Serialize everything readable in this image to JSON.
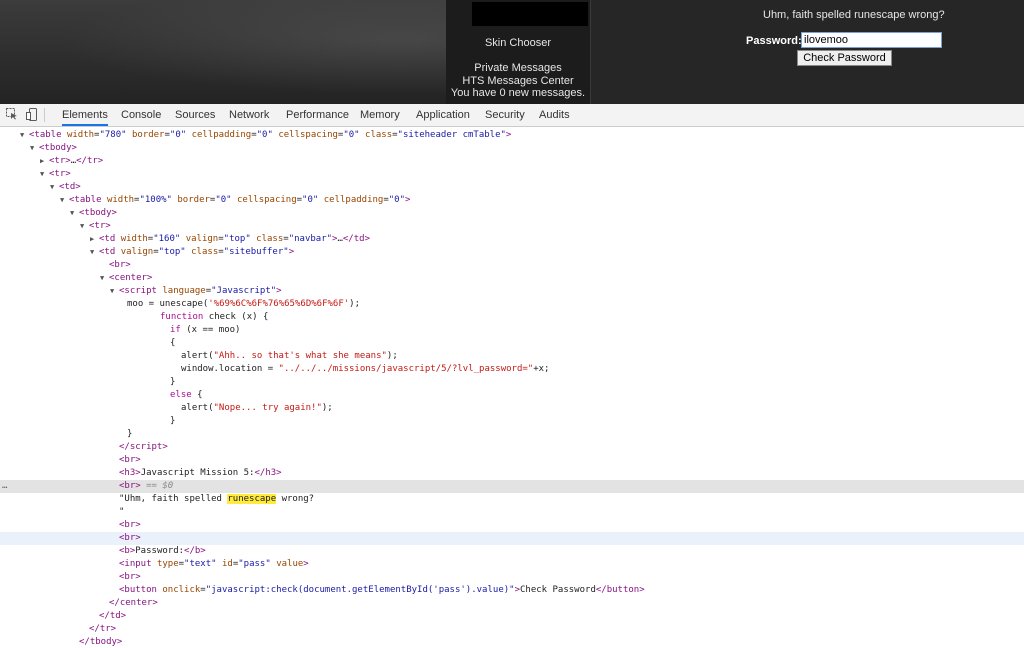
{
  "site": {
    "nav": {
      "skin_chooser": "Skin Chooser",
      "private_messages": "Private Messages",
      "hts_messages_center": "HTS Messages Center",
      "new_messages": "You have 0 new messages."
    },
    "mission": {
      "message": "Uhm, faith spelled runescape wrong?",
      "password_label": "Password:",
      "password_value": "ilovemoo",
      "check_button": "Check Password"
    }
  },
  "devtools": {
    "tabs": [
      "Elements",
      "Console",
      "Sources",
      "Network",
      "Performance",
      "Memory",
      "Application",
      "Security",
      "Audits"
    ],
    "active_tab": "Elements",
    "icons": [
      "inspect-icon",
      "device-toggle-icon"
    ],
    "lines": [
      {
        "indent": 0,
        "tri": "open",
        "html": "<span class='tag'>&lt;table</span> <span class='an'>width</span>=<span class='av'>\"780\"</span> <span class='an'>border</span>=<span class='av'>\"0\"</span> <span class='an'>cellpadding</span>=<span class='av'>\"0\"</span> <span class='an'>cellspacing</span>=<span class='av'>\"0\"</span> <span class='an'>class</span>=<span class='av'>\"siteheader cmTable\"</span><span class='tag'>&gt;</span>"
      },
      {
        "indent": 1,
        "tri": "open",
        "html": "<span class='tag'>&lt;tbody&gt;</span>"
      },
      {
        "indent": 2,
        "tri": "closed",
        "html": "<span class='tag'>&lt;tr&gt;</span>…<span class='tag'>&lt;/tr&gt;</span>"
      },
      {
        "indent": 2,
        "tri": "open",
        "html": "<span class='tag'>&lt;tr&gt;</span>"
      },
      {
        "indent": 3,
        "tri": "open",
        "html": "<span class='tag'>&lt;td&gt;</span>"
      },
      {
        "indent": 4,
        "tri": "open",
        "html": "<span class='tag'>&lt;table</span> <span class='an'>width</span>=<span class='av'>\"100%\"</span> <span class='an'>border</span>=<span class='av'>\"0\"</span> <span class='an'>cellspacing</span>=<span class='av'>\"0\"</span> <span class='an'>cellpadding</span>=<span class='av'>\"0\"</span><span class='tag'>&gt;</span>"
      },
      {
        "indent": 5,
        "tri": "open",
        "html": "<span class='tag'>&lt;tbody&gt;</span>"
      },
      {
        "indent": 6,
        "tri": "open",
        "html": "<span class='tag'>&lt;tr&gt;</span>"
      },
      {
        "indent": 7,
        "tri": "closed",
        "html": "<span class='tag'>&lt;td</span> <span class='an'>width</span>=<span class='av'>\"160\"</span> <span class='an'>valign</span>=<span class='av'>\"top\"</span> <span class='an'>class</span>=<span class='av'>\"navbar\"</span><span class='tag'>&gt;</span>…<span class='tag'>&lt;/td&gt;</span>"
      },
      {
        "indent": 7,
        "tri": "open",
        "html": "<span class='tag'>&lt;td</span> <span class='an'>valign</span>=<span class='av'>\"top\"</span> <span class='an'>class</span>=<span class='av'>\"sitebuffer\"</span><span class='tag'>&gt;</span>"
      },
      {
        "indent": 8,
        "tri": "none",
        "html": "<span class='tag'>&lt;br&gt;</span>"
      },
      {
        "indent": 8,
        "tri": "open",
        "html": "<span class='tag'>&lt;center&gt;</span>"
      },
      {
        "indent": 9,
        "tri": "open",
        "html": "<span class='tag'>&lt;script</span> <span class='an'>language</span>=<span class='av'>\"Javascript\"</span><span class='tag'>&gt;</span>"
      },
      {
        "indent": 0,
        "tri": "none",
        "pad": 127,
        "html": "<span class='js'>moo = unescape(</span><span class='str'>'%69%6C%6F%76%65%6D%6F%6F'</span><span class='js'>);</span>"
      },
      {
        "indent": 0,
        "tri": "none",
        "pad": 160,
        "html": "<span class='kw'>function</span><span class='js'> check (x) {</span>"
      },
      {
        "indent": 0,
        "tri": "none",
        "pad": 170,
        "html": "<span class='kw'>if</span><span class='js'> (x == moo)</span>"
      },
      {
        "indent": 0,
        "tri": "none",
        "pad": 170,
        "html": "<span class='js'>{</span>"
      },
      {
        "indent": 0,
        "tri": "none",
        "pad": 181,
        "html": "<span class='js'>alert(</span><span class='str'>\"Ahh.. so that's what she means\"</span><span class='js'>);</span>"
      },
      {
        "indent": 0,
        "tri": "none",
        "pad": 181,
        "html": "<span class='js'>window.location = </span><span class='str'>\"../../../missions/javascript/5/?lvl_password=\"</span><span class='js'>+x;</span>"
      },
      {
        "indent": 0,
        "tri": "none",
        "pad": 170,
        "html": "<span class='js'>}</span>"
      },
      {
        "indent": 0,
        "tri": "none",
        "pad": 170,
        "html": "<span class='kw'>else</span><span class='js'> {</span>"
      },
      {
        "indent": 0,
        "tri": "none",
        "pad": 181,
        "html": "<span class='js'>alert(</span><span class='str'>\"Nope... try again!\"</span><span class='js'>);</span>"
      },
      {
        "indent": 0,
        "tri": "none",
        "pad": 170,
        "html": "<span class='js'>}</span>"
      },
      {
        "indent": 0,
        "tri": "none",
        "pad": 127,
        "html": "<span class='js'>}</span>"
      },
      {
        "indent": 9,
        "tri": "none",
        "html": "<span class='tag'>&lt;/script&gt;</span>"
      },
      {
        "indent": 9,
        "tri": "none",
        "html": "<span class='tag'>&lt;br&gt;</span>"
      },
      {
        "indent": 9,
        "tri": "none",
        "html": "<span class='tag'>&lt;h3&gt;</span>Javascript Mission 5:<span class='tag'>&lt;/h3&gt;</span>"
      },
      {
        "indent": 9,
        "tri": "none",
        "cls": "sel",
        "dots": true,
        "html": "<span class='tag'>&lt;br&gt;</span> <span class='eq'>== $0</span>"
      },
      {
        "indent": 9,
        "tri": "none",
        "html": "\"Uhm, faith spelled <span class='hl'>runescape</span> wrong?"
      },
      {
        "indent": 9,
        "tri": "none",
        "html": "\""
      },
      {
        "indent": 9,
        "tri": "none",
        "html": "<span class='tag'>&lt;br&gt;</span>"
      },
      {
        "indent": 9,
        "tri": "none",
        "cls": "hov",
        "html": "<span class='tag'>&lt;br&gt;</span>"
      },
      {
        "indent": 9,
        "tri": "none",
        "html": "<span class='tag'>&lt;b&gt;</span>Password:<span class='tag'>&lt;/b&gt;</span>"
      },
      {
        "indent": 9,
        "tri": "none",
        "html": "<span class='tag'>&lt;input</span> <span class='an'>type</span>=<span class='av'>\"text\"</span> <span class='an'>id</span>=<span class='av'>\"pass\"</span> <span class='an'>value</span><span class='tag'>&gt;</span>"
      },
      {
        "indent": 9,
        "tri": "none",
        "html": "<span class='tag'>&lt;br&gt;</span>"
      },
      {
        "indent": 9,
        "tri": "none",
        "html": "<span class='tag'>&lt;button</span> <span class='an'>onclick</span>=<span class='av'>\"javascript:check(document.getElementById('pass').value)\"</span><span class='tag'>&gt;</span>Check Password<span class='tag'>&lt;/button&gt;</span>"
      },
      {
        "indent": 8,
        "tri": "none",
        "html": "<span class='tag'>&lt;/center&gt;</span>"
      },
      {
        "indent": 7,
        "tri": "none",
        "html": "<span class='tag'>&lt;/td&gt;</span>"
      },
      {
        "indent": 6,
        "tri": "none",
        "html": "<span class='tag'>&lt;/tr&gt;</span>"
      },
      {
        "indent": 5,
        "tri": "none",
        "html": "<span class='tag'>&lt;/tbody&gt;</span>"
      }
    ]
  },
  "colors": {
    "active_tab_underline": "#1a73e8",
    "tag": "#881280",
    "attr_name": "#994500",
    "attr_value": "#1a1aa6",
    "search_highlight": "#ffeb3b"
  }
}
